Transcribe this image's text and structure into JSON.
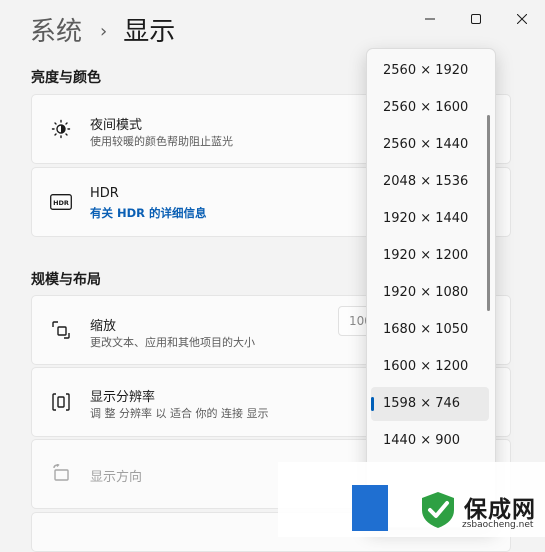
{
  "window": {
    "minimize_icon": "minimize-icon",
    "maximize_icon": "maximize-icon",
    "close_icon": "close-icon"
  },
  "breadcrumb": {
    "parent": "系统",
    "separator": "›",
    "current": "显示"
  },
  "sections": {
    "brightness_color": "亮度与颜色",
    "scale_layout": "规模与布局"
  },
  "cards": {
    "night_light": {
      "title": "夜间模式",
      "subtitle": "使用较暖的颜色帮助阻止蓝光",
      "icon": "brightness-icon"
    },
    "hdr": {
      "title": "HDR",
      "link": "有关 HDR 的详细信息",
      "icon": "hdr-icon"
    },
    "scale": {
      "title": "缩放",
      "subtitle": "更改文本、应用和其他项目的大小",
      "value": "100",
      "icon": "scale-icon"
    },
    "resolution": {
      "title": "显示分辨率",
      "subtitle": "调 整 分辨率 以 适合 你的 连接 显示",
      "icon": "resolution-icon"
    },
    "orientation": {
      "title": "显示方向",
      "icon": "orientation-icon",
      "disabled": true
    }
  },
  "resolution_dropdown": {
    "options": [
      "2560 × 1920",
      "2560 × 1600",
      "2560 × 1440",
      "2048 × 1536",
      "1920 × 1440",
      "1920 × 1200",
      "1920 × 1080",
      "1680 × 1050",
      "1600 × 1200",
      "1598 × 746",
      "1440 × 900"
    ],
    "selected": "1598 × 746",
    "accent": "#005fb8"
  },
  "watermark": {
    "name": "保成网",
    "url": "zsbaocheng.net"
  }
}
